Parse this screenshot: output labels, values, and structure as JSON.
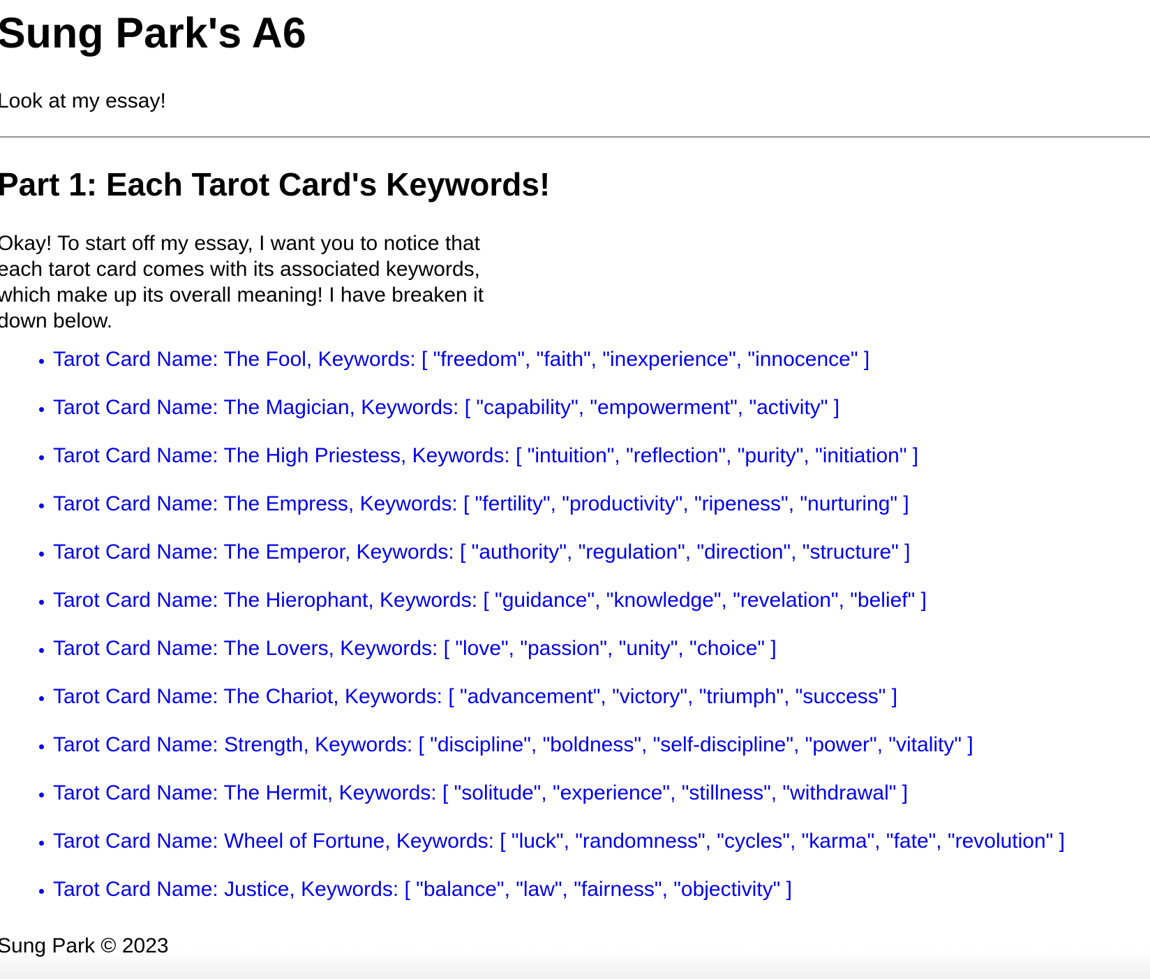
{
  "header": {
    "title": "Sung Park's A6",
    "tagline": "Look at my essay!"
  },
  "section": {
    "heading": "Part 1: Each Tarot Card's Keywords!",
    "intro": "Okay! To start off my essay, I want you to notice that each tarot card comes with its associated keywords, which make up its overall meaning! I have breaken it down below."
  },
  "cards": [
    {
      "text": "Tarot Card Name: The Fool, Keywords: [ \"freedom\", \"faith\", \"inexperience\", \"innocence\" ]"
    },
    {
      "text": "Tarot Card Name: The Magician, Keywords: [ \"capability\", \"empowerment\", \"activity\" ]"
    },
    {
      "text": "Tarot Card Name: The High Priestess, Keywords: [ \"intuition\", \"reflection\", \"purity\", \"initiation\" ]"
    },
    {
      "text": "Tarot Card Name: The Empress, Keywords: [ \"fertility\", \"productivity\", \"ripeness\", \"nurturing\" ]"
    },
    {
      "text": "Tarot Card Name: The Emperor, Keywords: [ \"authority\", \"regulation\", \"direction\", \"structure\" ]"
    },
    {
      "text": "Tarot Card Name: The Hierophant, Keywords: [ \"guidance\", \"knowledge\", \"revelation\", \"belief\" ]"
    },
    {
      "text": "Tarot Card Name: The Lovers, Keywords: [ \"love\", \"passion\", \"unity\", \"choice\" ]"
    },
    {
      "text": "Tarot Card Name: The Chariot, Keywords: [ \"advancement\", \"victory\", \"triumph\", \"success\" ]"
    },
    {
      "text": "Tarot Card Name: Strength, Keywords: [ \"discipline\", \"boldness\", \"self-discipline\", \"power\", \"vitality\" ]"
    },
    {
      "text": "Tarot Card Name: The Hermit, Keywords: [ \"solitude\", \"experience\", \"stillness\", \"withdrawal\" ]"
    },
    {
      "text": "Tarot Card Name: Wheel of Fortune, Keywords: [ \"luck\", \"randomness\", \"cycles\", \"karma\", \"fate\", \"revolution\" ]"
    },
    {
      "text": "Tarot Card Name: Justice, Keywords: [ \"balance\", \"law\", \"fairness\", \"objectivity\" ]"
    }
  ],
  "footer": {
    "text": "Sung Park © 2023"
  },
  "colors": {
    "link": "#0000ee",
    "text": "#000000",
    "divider": "#9a9a9a",
    "background": "#ffffff"
  }
}
